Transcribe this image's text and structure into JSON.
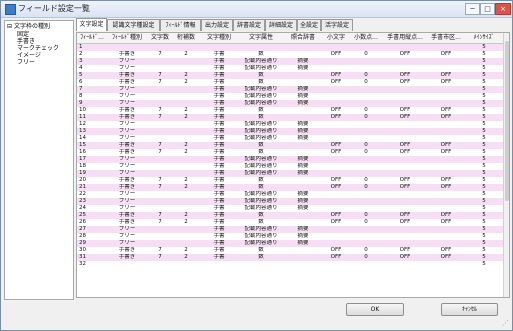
{
  "window": {
    "title": "フィールド設定一覧",
    "min": "─",
    "max": "□",
    "close": "×"
  },
  "tree": {
    "root": "文字枠の種別",
    "children": [
      "固定",
      "手書き",
      "マークチェック",
      "イメージ",
      "フリー"
    ]
  },
  "tabs": [
    "文字設定",
    "認識文字種設定",
    "ﾌｨｰﾙﾄﾞ情報",
    "出力設定",
    "辞書設定",
    "詳細設定",
    "全設定",
    "活字設定"
  ],
  "columns": [
    "ﾌｨｰﾙﾄﾞ...",
    "ﾌｨｰﾙﾄﾞ種別",
    "文字数",
    "桁補数",
    "文字種別",
    "文字属性",
    "照合辞書",
    "小文字",
    "小数点...",
    "手書用縦点...",
    "手書市区...",
    "ﾒｲﾝｻｲｽﾞ"
  ],
  "rows": [
    [
      "1",
      "",
      "",
      "",
      "",
      "",
      "",
      "",
      "",
      "",
      "",
      "5"
    ],
    [
      "2",
      "手書き",
      "7",
      "2",
      "手書",
      "数",
      "",
      "OFF",
      "0",
      "OFF",
      "OFF",
      "5"
    ],
    [
      "3",
      "フリー",
      "",
      "",
      "手書",
      "記載内容通り",
      "摘要",
      "",
      "",
      "",
      "",
      "5"
    ],
    [
      "4",
      "フリー",
      "",
      "",
      "手書",
      "記載内容通り",
      "摘要",
      "",
      "",
      "",
      "",
      "5"
    ],
    [
      "5",
      "手書き",
      "7",
      "2",
      "手書",
      "数",
      "",
      "OFF",
      "0",
      "OFF",
      "OFF",
      "5"
    ],
    [
      "6",
      "手書き",
      "7",
      "2",
      "手書",
      "数",
      "",
      "OFF",
      "0",
      "OFF",
      "OFF",
      "5"
    ],
    [
      "7",
      "フリー",
      "",
      "",
      "手書",
      "記載内容通り",
      "摘要",
      "",
      "",
      "",
      "",
      "5"
    ],
    [
      "8",
      "フリー",
      "",
      "",
      "手書",
      "記載内容通り",
      "摘要",
      "",
      "",
      "",
      "",
      "5"
    ],
    [
      "9",
      "フリー",
      "",
      "",
      "手書",
      "記載内容通り",
      "摘要",
      "",
      "",
      "",
      "",
      "5"
    ],
    [
      "10",
      "手書き",
      "7",
      "2",
      "手書",
      "数",
      "",
      "OFF",
      "0",
      "OFF",
      "OFF",
      "5"
    ],
    [
      "11",
      "手書き",
      "7",
      "2",
      "手書",
      "数",
      "",
      "OFF",
      "0",
      "OFF",
      "OFF",
      "5"
    ],
    [
      "12",
      "フリー",
      "",
      "",
      "手書",
      "記載内容通り",
      "摘要",
      "",
      "",
      "",
      "",
      "5"
    ],
    [
      "13",
      "フリー",
      "",
      "",
      "手書",
      "記載内容通り",
      "摘要",
      "",
      "",
      "",
      "",
      "5"
    ],
    [
      "14",
      "フリー",
      "",
      "",
      "手書",
      "記載内容通り",
      "摘要",
      "",
      "",
      "",
      "",
      "5"
    ],
    [
      "15",
      "手書き",
      "7",
      "2",
      "手書",
      "数",
      "",
      "OFF",
      "0",
      "OFF",
      "OFF",
      "5"
    ],
    [
      "16",
      "手書き",
      "7",
      "2",
      "手書",
      "数",
      "",
      "OFF",
      "0",
      "OFF",
      "OFF",
      "5"
    ],
    [
      "17",
      "フリー",
      "",
      "",
      "手書",
      "記載内容通り",
      "摘要",
      "",
      "",
      "",
      "",
      "5"
    ],
    [
      "18",
      "フリー",
      "",
      "",
      "手書",
      "記載内容通り",
      "摘要",
      "",
      "",
      "",
      "",
      "5"
    ],
    [
      "19",
      "フリー",
      "",
      "",
      "手書",
      "記載内容通り",
      "摘要",
      "",
      "",
      "",
      "",
      "5"
    ],
    [
      "20",
      "手書き",
      "7",
      "2",
      "手書",
      "数",
      "",
      "OFF",
      "0",
      "OFF",
      "OFF",
      "5"
    ],
    [
      "21",
      "手書き",
      "7",
      "2",
      "手書",
      "数",
      "",
      "OFF",
      "0",
      "OFF",
      "OFF",
      "5"
    ],
    [
      "22",
      "フリー",
      "",
      "",
      "手書",
      "記載内容通り",
      "摘要",
      "",
      "",
      "",
      "",
      "5"
    ],
    [
      "23",
      "フリー",
      "",
      "",
      "手書",
      "記載内容通り",
      "摘要",
      "",
      "",
      "",
      "",
      "5"
    ],
    [
      "24",
      "フリー",
      "",
      "",
      "手書",
      "記載内容通り",
      "摘要",
      "",
      "",
      "",
      "",
      "5"
    ],
    [
      "25",
      "手書き",
      "7",
      "2",
      "手書",
      "数",
      "",
      "OFF",
      "0",
      "OFF",
      "OFF",
      "5"
    ],
    [
      "26",
      "手書き",
      "7",
      "2",
      "手書",
      "数",
      "",
      "OFF",
      "0",
      "OFF",
      "OFF",
      "5"
    ],
    [
      "27",
      "フリー",
      "",
      "",
      "手書",
      "記載内容通り",
      "摘要",
      "",
      "",
      "",
      "",
      "5"
    ],
    [
      "28",
      "フリー",
      "",
      "",
      "手書",
      "記載内容通り",
      "摘要",
      "",
      "",
      "",
      "",
      "5"
    ],
    [
      "29",
      "フリー",
      "",
      "",
      "手書",
      "記載内容通り",
      "摘要",
      "",
      "",
      "",
      "",
      "5"
    ],
    [
      "30",
      "手書き",
      "7",
      "2",
      "手書",
      "数",
      "",
      "OFF",
      "0",
      "OFF",
      "OFF",
      "5"
    ],
    [
      "31",
      "手書き",
      "7",
      "2",
      "手書",
      "数",
      "",
      "OFF",
      "0",
      "OFF",
      "OFF",
      "5"
    ],
    [
      "32",
      "",
      "",
      "",
      "",
      "",
      "",
      "",
      "",
      "",
      "",
      "5"
    ]
  ],
  "buttons": {
    "ok": "OK",
    "cancel": "ｷｬﾝｾﾙ"
  }
}
